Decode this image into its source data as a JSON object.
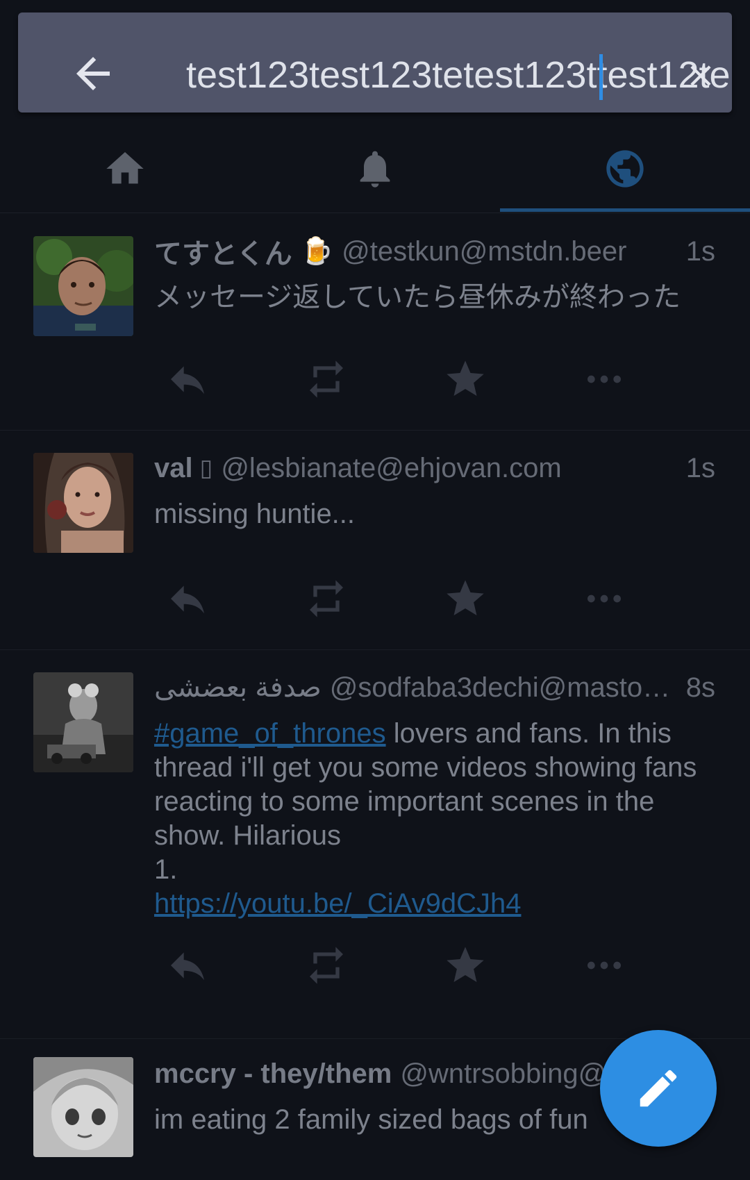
{
  "search": {
    "query": "test123test123tetest123ttest12te",
    "placeholder": ""
  },
  "tabs": [
    {
      "name": "home",
      "icon": "home-icon"
    },
    {
      "name": "notifications",
      "icon": "bell-icon"
    },
    {
      "name": "public",
      "icon": "globe-icon",
      "selected": true
    }
  ],
  "statuses": [
    {
      "display_name": "てすとくん",
      "emoji": "🍺",
      "acct": "@testkun@mstdn.beer",
      "time": "1s",
      "content": "メッセージ返していたら昼休みが終わった"
    },
    {
      "display_name": "val",
      "emoji": "",
      "acct": "@lesbianate@ehjovan.com",
      "time": "1s",
      "content": "missing huntie..."
    },
    {
      "display_name": "صدفة بعضشى",
      "emoji": "",
      "acct": "@sodfaba3dechi@masto…",
      "time": "8s",
      "hashtag": "#game_of_thrones",
      "content_after_tag": " lovers and fans. In this thread i'll get you some videos showing fans reacting to some important scenes in the show. Hilarious",
      "content_line2": "1.",
      "link": "https://youtu.be/_CiAv9dCJh4"
    },
    {
      "display_name": "mccry - they/them",
      "acct": "@wntrsobbing@",
      "time": "",
      "content": "im eating 2 family sized bags of fun"
    }
  ],
  "colors": {
    "accent": "#2d8ee3",
    "search_bg": "#505469",
    "background": "#0f1219",
    "link": "#1f5a8e"
  },
  "icons": {
    "back": "arrow-left-icon",
    "clear": "close-icon",
    "reply": "reply-icon",
    "boost": "retweet-icon",
    "favourite": "star-icon",
    "more": "ellipsis-icon",
    "compose": "pencil-icon"
  }
}
